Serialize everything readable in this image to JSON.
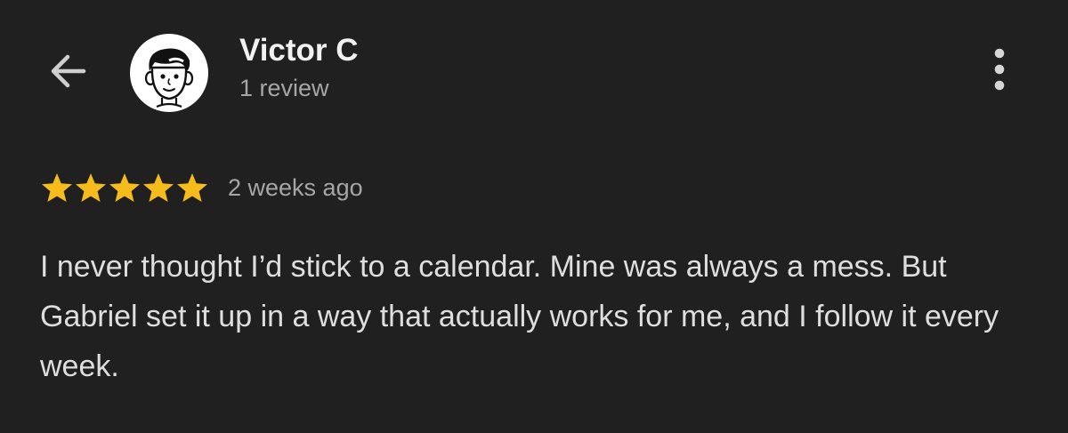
{
  "reviewer": {
    "name": "Victor C",
    "review_count": "1 review"
  },
  "icons": {
    "back": "back-arrow-icon",
    "avatar": "cartoon-face-avatar",
    "more": "more-vertical-icon",
    "star": "star-icon"
  },
  "review": {
    "rating": 5,
    "rating_max": 5,
    "date": "2 weeks ago",
    "text": "I never thought I’d stick to a calendar. Mine was always a mess. But Gabriel set it up in a way that actually works for me, and I follow it every week."
  },
  "colors": {
    "background": "#202020",
    "star": "#f6bb1c",
    "primary_text": "#f1f1f1",
    "secondary_text": "#a6a6a6"
  }
}
